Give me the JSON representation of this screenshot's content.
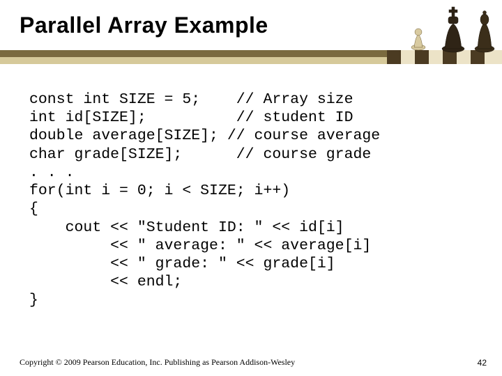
{
  "slide": {
    "title": "Parallel Array Example",
    "code": "const int SIZE = 5;    // Array size\nint id[SIZE];          // student ID\ndouble average[SIZE]; // course average\nchar grade[SIZE];      // course grade\n. . .\nfor(int i = 0; i < SIZE; i++)\n{\n    cout << \"Student ID: \" << id[i]\n         << \" average: \" << average[i]\n         << \" grade: \" << grade[i]\n         << endl;\n}",
    "copyright": "Copyright © 2009 Pearson Education, Inc. Publishing as Pearson Addison-Wesley",
    "page_number": "42"
  }
}
